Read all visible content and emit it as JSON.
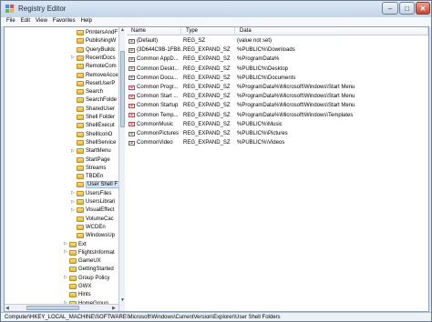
{
  "window": {
    "title": "Registry Editor"
  },
  "menu": [
    "File",
    "Edit",
    "View",
    "Favorites",
    "Help"
  ],
  "tree": {
    "items": [
      {
        "label": "PrintersAndF",
        "expander": "",
        "selected": false
      },
      {
        "label": "PublishingW",
        "expander": "",
        "selected": false
      },
      {
        "label": "QueryBuildc",
        "expander": "",
        "selected": false
      },
      {
        "label": "RecentDocs",
        "expander": "▷",
        "selected": false
      },
      {
        "label": "RemoteCom",
        "expander": "",
        "selected": false
      },
      {
        "label": "RemoveAcce",
        "expander": "",
        "selected": false
      },
      {
        "label": "ResetUserP",
        "expander": "",
        "selected": false
      },
      {
        "label": "Search",
        "expander": "",
        "selected": false
      },
      {
        "label": "SearchFolde",
        "expander": "",
        "selected": false
      },
      {
        "label": "SharedUser",
        "expander": "",
        "selected": false
      },
      {
        "label": "Shell Folder",
        "expander": "",
        "selected": false
      },
      {
        "label": "ShellExecut",
        "expander": "",
        "selected": false
      },
      {
        "label": "ShellIconO",
        "expander": "",
        "selected": false
      },
      {
        "label": "ShellService",
        "expander": "",
        "selected": false
      },
      {
        "label": "StartMenu",
        "expander": "▷",
        "selected": false
      },
      {
        "label": "StartPage",
        "expander": "",
        "selected": false
      },
      {
        "label": "Streams",
        "expander": "",
        "selected": false
      },
      {
        "label": "TBDEn",
        "expander": "",
        "selected": false
      },
      {
        "label": "User Shell F",
        "expander": "",
        "selected": true
      },
      {
        "label": "UsersFiles",
        "expander": "▷",
        "selected": false
      },
      {
        "label": "UsersLibrari",
        "expander": "▷",
        "selected": false
      },
      {
        "label": "VisualEffect",
        "expander": "▷",
        "selected": false
      },
      {
        "label": "VolumeCac",
        "expander": "",
        "selected": false
      },
      {
        "label": "WCDEn",
        "expander": "",
        "selected": false
      },
      {
        "label": "WindowsUp",
        "expander": "",
        "selected": false
      },
      {
        "label": "Ext",
        "expander": "▷",
        "selected": false,
        "level": 1
      },
      {
        "label": "FlightsInformat",
        "expander": "▷",
        "selected": false,
        "level": 1
      },
      {
        "label": "GameUX",
        "expander": "",
        "selected": false,
        "level": 1
      },
      {
        "label": "GettingStarted",
        "expander": "",
        "selected": false,
        "level": 1
      },
      {
        "label": "Group Policy",
        "expander": "▷",
        "selected": false,
        "level": 1
      },
      {
        "label": "GWX",
        "expander": "",
        "selected": false,
        "level": 1
      },
      {
        "label": "Hints",
        "expander": "",
        "selected": false,
        "level": 1
      },
      {
        "label": "HomeGroup",
        "expander": "▷",
        "selected": false,
        "level": 1
      }
    ]
  },
  "list": {
    "headers": {
      "name": "Name",
      "type": "Type",
      "data": "Data"
    },
    "rows": [
      {
        "name": "(Default)",
        "type": "REG_SZ",
        "data": "(value not set)"
      },
      {
        "name": "{3D644C9B-1FB8...",
        "type": "REG_EXPAND_SZ",
        "data": "%PUBLIC%\\Downloads"
      },
      {
        "name": "Common AppD...",
        "type": "REG_EXPAND_SZ",
        "data": "%ProgramData%"
      },
      {
        "name": "Common Deskt...",
        "type": "REG_EXPAND_SZ",
        "data": "%PUBLIC%\\Desktop"
      },
      {
        "name": "Common Docu...",
        "type": "REG_EXPAND_SZ",
        "data": "%PUBLIC%\\Documents"
      },
      {
        "name": "Common Progr...",
        "type": "REG_EXPAND_SZ",
        "data": "%ProgramData%\\Microsoft\\Windows\\Start Menu"
      },
      {
        "name": "Common Start ...",
        "type": "REG_EXPAND_SZ",
        "data": "%ProgramData%\\Microsoft\\Windows\\Start Menu"
      },
      {
        "name": "Common Startup",
        "type": "REG_EXPAND_SZ",
        "data": "%ProgramData%\\Microsoft\\Windows\\Start Menu"
      },
      {
        "name": "Common Temp...",
        "type": "REG_EXPAND_SZ",
        "data": "%ProgramData%\\Microsoft\\Windows\\Templates"
      },
      {
        "name": "CommonMusic",
        "type": "REG_EXPAND_SZ",
        "data": "%PUBLIC%\\Music"
      },
      {
        "name": "CommonPictures",
        "type": "REG_EXPAND_SZ",
        "data": "%PUBLIC%\\Pictures"
      },
      {
        "name": "CommonVideo",
        "type": "REG_EXPAND_SZ",
        "data": "%PUBLIC%\\Videos"
      }
    ]
  },
  "status": {
    "path": "Computer\\HKEY_LOCAL_MACHINE\\SOFTWARE\\Microsoft\\Windows\\CurrentVersion\\Explorer\\User Shell Folders"
  },
  "icons": {
    "app": "registry-editor-icon",
    "value": "string-value-icon",
    "folder": "folder-icon"
  },
  "colors": {
    "selection": "#d8e6f7",
    "folder": "#f0cf6a",
    "title_bar": "#c4d4e8"
  }
}
